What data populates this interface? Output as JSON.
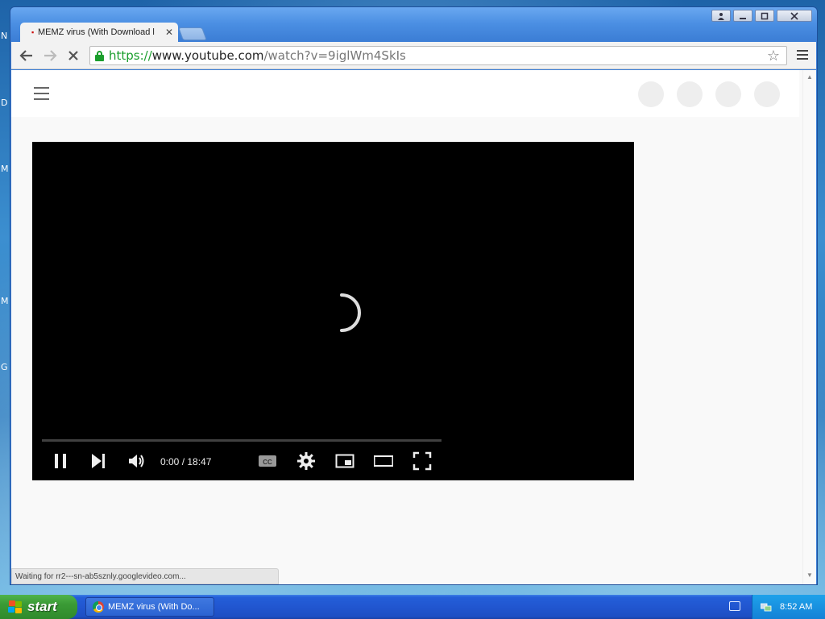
{
  "desktop": {
    "letters": [
      "N",
      "D",
      "M",
      "M",
      "G"
    ]
  },
  "window": {
    "controls": [
      "user",
      "minimize",
      "maximize",
      "close"
    ]
  },
  "tab": {
    "title": "MEMZ virus (With Download l",
    "close": "✕"
  },
  "omnibox": {
    "scheme": "https://",
    "host": "www.youtube.com",
    "path": "/watch?v=9iglWm4SkIs"
  },
  "player": {
    "time": "0:00 / 18:47",
    "progress": 0,
    "state": "loading"
  },
  "status": {
    "text": "Waiting for rr2---sn-ab5sznly.googlevideo.com..."
  },
  "taskbar": {
    "start_label": "start",
    "task_title": "MEMZ virus (With Do...",
    "clock": "8:52 AM"
  },
  "colors": {
    "secure_green": "#1a9e2c",
    "player_bg": "#000000",
    "taskbar_blue": "#245ed8",
    "start_green": "#3a9a35"
  }
}
